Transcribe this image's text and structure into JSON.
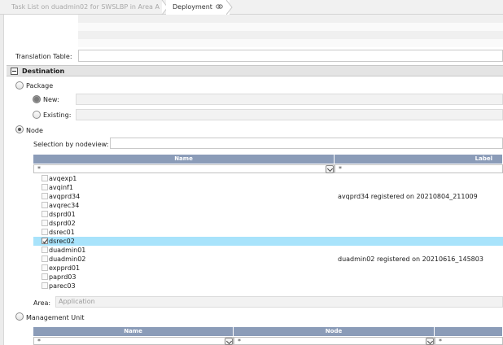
{
  "breadcrumb": {
    "items": [
      {
        "label": "Task List on duadmin02 for SWSLBP in Area A"
      },
      {
        "label": "Deployment"
      }
    ],
    "deployment_icon": "link-icon"
  },
  "translation_table": {
    "label": "Translation Table:",
    "value": ""
  },
  "destination": {
    "title": "Destination",
    "package": {
      "label": "Package",
      "new_label": "New:",
      "existing_label": "Existing:"
    },
    "node": {
      "label": "Node",
      "selection_label": "Selection by nodeview:",
      "grid": {
        "columns": [
          "Name",
          "Label"
        ],
        "filters": [
          "*",
          "*"
        ],
        "rows": [
          {
            "name": "avqexp1",
            "label": "",
            "checked": false
          },
          {
            "name": "avqinf1",
            "label": "",
            "checked": false
          },
          {
            "name": "avqprd34",
            "label": "avqprd34 registered on 20210804_211009",
            "checked": false
          },
          {
            "name": "avqrec34",
            "label": "",
            "checked": false
          },
          {
            "name": "dsprd01",
            "label": "",
            "checked": false
          },
          {
            "name": "dsprd02",
            "label": "",
            "checked": false
          },
          {
            "name": "dsrec01",
            "label": "",
            "checked": false
          },
          {
            "name": "dsrec02",
            "label": "",
            "checked": true
          },
          {
            "name": "duadmin01",
            "label": "",
            "checked": false
          },
          {
            "name": "duadmin02",
            "label": "duadmin02 registered on 20210616_145803",
            "checked": false
          },
          {
            "name": "expprd01",
            "label": "",
            "checked": false
          },
          {
            "name": "paprd03",
            "label": "",
            "checked": false
          },
          {
            "name": "parec03",
            "label": "",
            "checked": false
          }
        ]
      },
      "area_label": "Area:",
      "area_placeholder": "Application"
    },
    "management_unit": {
      "label": "Management Unit",
      "grid": {
        "columns": [
          "Name",
          "Node"
        ],
        "filters": [
          "*",
          "*",
          "*"
        ]
      }
    }
  },
  "colors": {
    "grid_header": "#8b9cb8",
    "selected_row": "#a8e3fb",
    "section_header": "#e4e4e4"
  }
}
